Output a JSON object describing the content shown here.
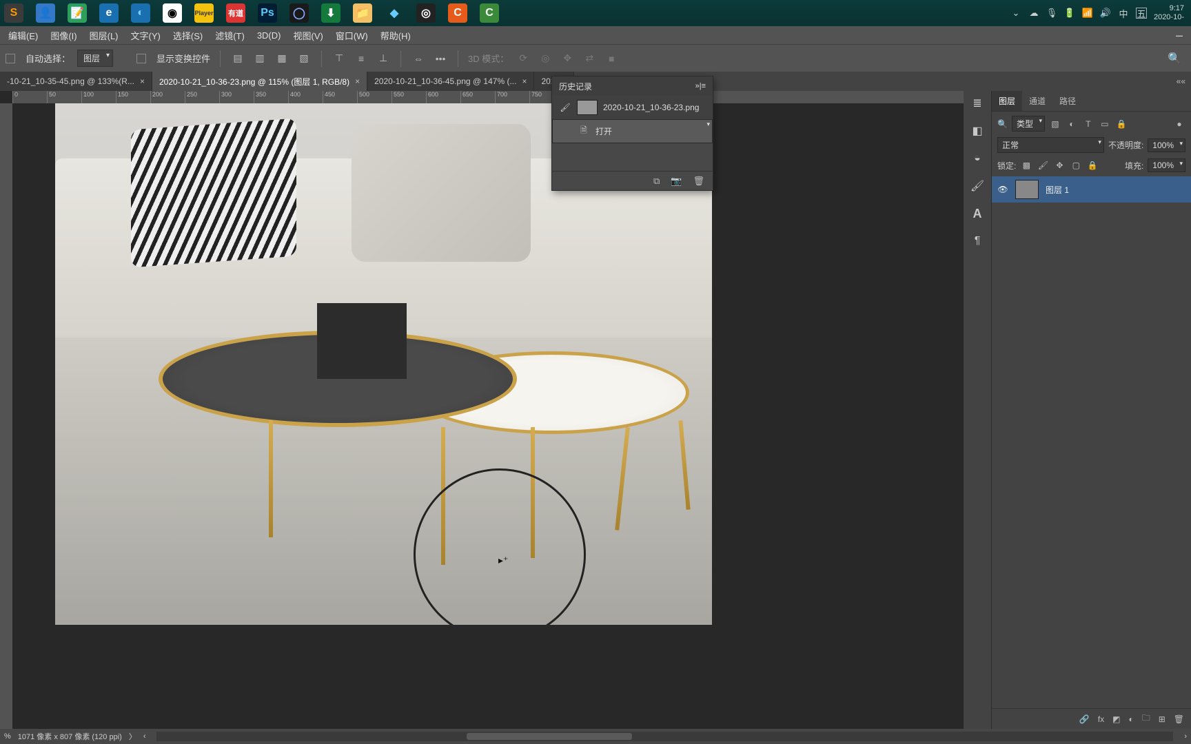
{
  "taskbar": {
    "apps": [
      "Sublime",
      "User",
      "Notepad",
      "Edge",
      "Browser",
      "Chrome",
      "Player",
      "有道",
      "Ps",
      "C4D",
      "IDM",
      "Explorer",
      "Diamond",
      "Obs",
      "Camtasia",
      "Camtasia2"
    ],
    "sys": {
      "ime1": "中",
      "ime2": "五"
    },
    "time": "9:17",
    "date": "2020-10-"
  },
  "menubar": {
    "items": [
      "编辑(E)",
      "图像(I)",
      "图层(L)",
      "文字(Y)",
      "选择(S)",
      "滤镜(T)",
      "3D(D)",
      "视图(V)",
      "窗口(W)",
      "帮助(H)"
    ]
  },
  "optbar": {
    "auto_select": "自动选择：",
    "target": "图层",
    "show_transform": "显示变换控件",
    "mode3d": "3D 模式："
  },
  "tabs": [
    {
      "label": "-10-21_10-35-45.png @ 133%(R...",
      "active": false
    },
    {
      "label": "2020-10-21_10-36-23.png @ 115% (图层 1, RGB/8)",
      "active": true
    },
    {
      "label": "2020-10-21_10-36-45.png @ 147% (...",
      "active": false
    },
    {
      "label": "2020...",
      "active": false
    }
  ],
  "ruler_marks": [
    "0",
    "50",
    "100",
    "150",
    "200",
    "250",
    "300",
    "350",
    "400",
    "450",
    "500",
    "550",
    "600",
    "650",
    "700",
    "750"
  ],
  "history": {
    "title": "历史记录",
    "snapshot": "2020-10-21_10-36-23.png",
    "steps": [
      "打开"
    ]
  },
  "layers_panel": {
    "tabs": [
      "图层",
      "通道",
      "路径"
    ],
    "filter_label": "类型",
    "blend_mode": "正常",
    "opacity_label": "不透明度:",
    "opacity_value": "100%",
    "lock_label": "锁定:",
    "fill_label": "填充:",
    "fill_value": "100%",
    "items": [
      {
        "name": "图层 1"
      }
    ]
  },
  "statusbar": {
    "zoom": "%",
    "doc": "1071 像素 x 807 像素 (120 ppi)"
  }
}
